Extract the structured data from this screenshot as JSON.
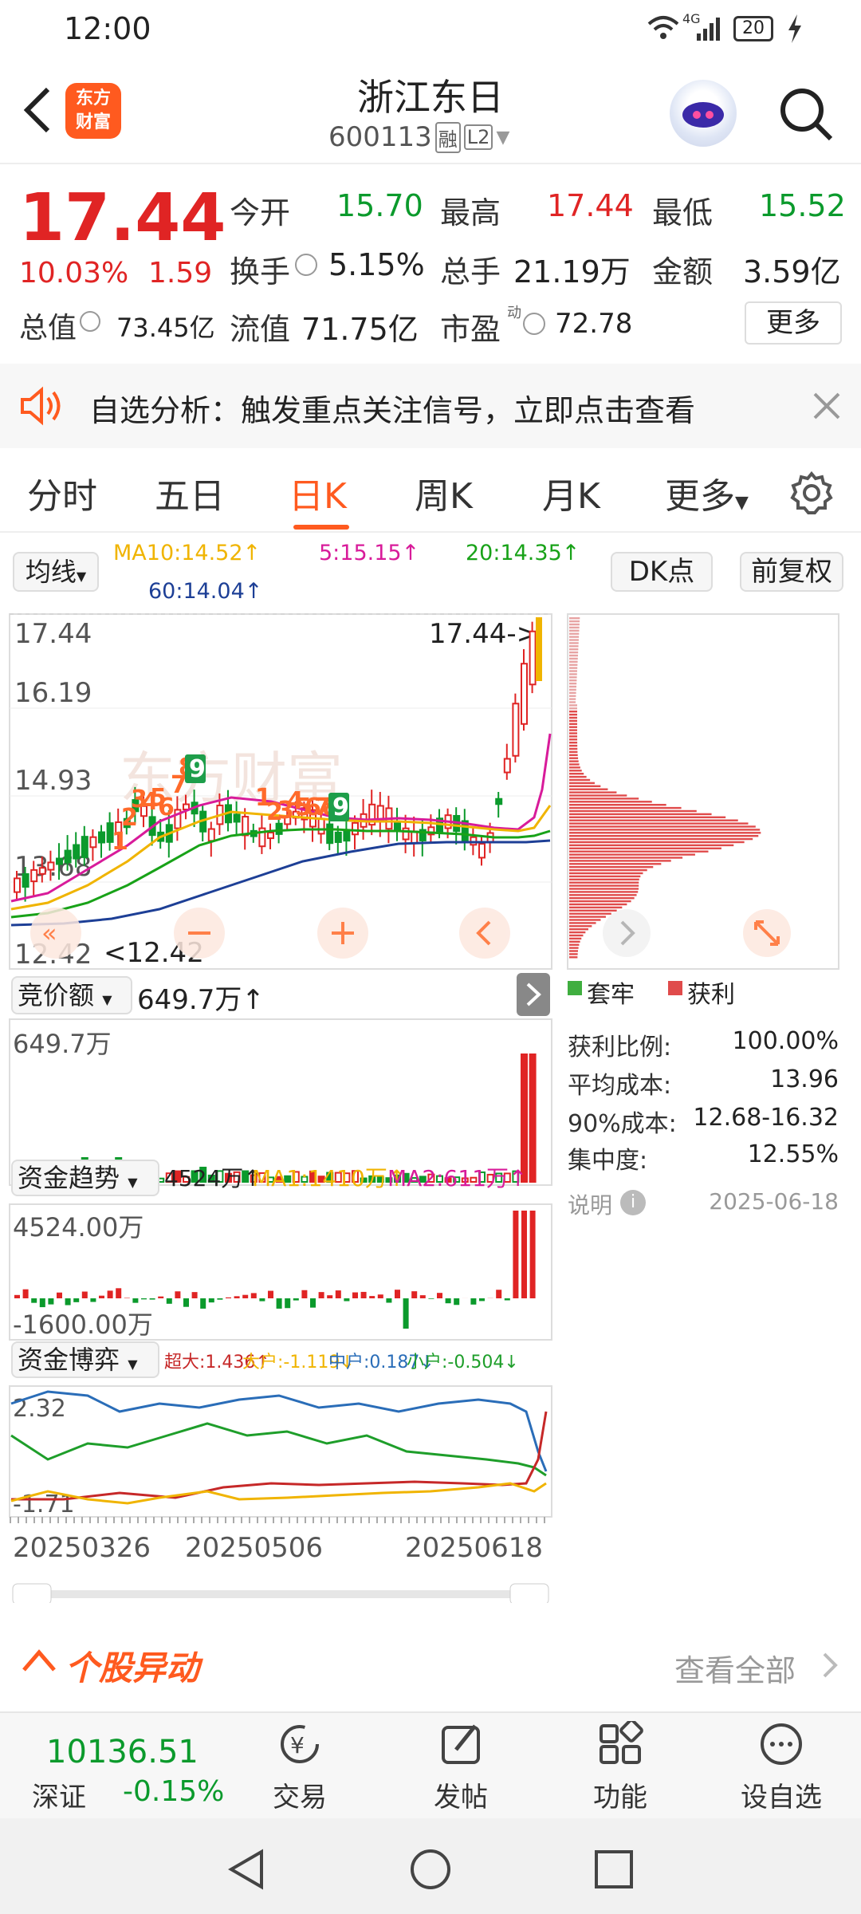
{
  "status": {
    "time": "12:00",
    "network": "4G",
    "battery": "20"
  },
  "header": {
    "title": "浙江东日",
    "code": "600113",
    "tag1": "融",
    "tag2": "L2",
    "logo_line1": "东方",
    "logo_line2": "财富"
  },
  "quote": {
    "price": "17.44",
    "pct": "10.03%",
    "change": "1.59",
    "open_label": "今开",
    "open": "15.70",
    "high_label": "最高",
    "high": "17.44",
    "low_label": "最低",
    "low": "15.52",
    "turnover_label": "换手",
    "turnover": "5.15%",
    "volume_label": "总手",
    "volume": "21.19万",
    "amount_label": "金额",
    "amount": "3.59亿",
    "mcap_label": "总值",
    "mcap": "73.45亿",
    "float_label": "流值",
    "float": "71.75亿",
    "pe_label": "市盈",
    "pe_sup": "动",
    "pe": "72.78",
    "more": "更多"
  },
  "notice": {
    "text": "自选分析：触发重点关注信号，立即点击查看"
  },
  "tabs": [
    "分时",
    "五日",
    "日K",
    "周K",
    "月K",
    "更多"
  ],
  "active_tab": "日K",
  "ma": {
    "selector": "均线",
    "ma10": "MA10:14.52↑",
    "ma5": "5:15.15↑",
    "ma20": "20:14.35↑",
    "ma60": "60:14.04↑",
    "dk": "DK点",
    "adjust": "前复权"
  },
  "kline": {
    "ticks": [
      "17.44",
      "16.19",
      "14.93",
      "13.68",
      "12.42"
    ],
    "last_tag": "17.44->",
    "low_tag": "<12.42",
    "watermark": "东方财富",
    "seq1": [
      "1",
      "2",
      "3",
      "4",
      "5",
      "6",
      "7",
      "8",
      "9"
    ],
    "seq2": [
      "1",
      "2",
      "3",
      "4",
      "5",
      "6",
      "7",
      "8",
      "9"
    ]
  },
  "volume_panel": {
    "selector": "竞价额",
    "value": "649.7万↑",
    "ymax": "649.7万"
  },
  "flow_panel": {
    "selector": "资金趋势",
    "value": "4524万↑",
    "ma1": "MA1:1410万↑",
    "ma2": "MA2:611万↑",
    "ymax": "4524.00万",
    "ymin": "-1600.00万"
  },
  "game_panel": {
    "selector": "资金博弈",
    "super": "超大:1.436↑",
    "big": "大户:-1.119↓",
    "mid": "中户:0.187↓",
    "small": "小户:-0.504↓",
    "ymax": "2.32",
    "ymin": "-1.71"
  },
  "dates": [
    "20250326",
    "20250506",
    "20250618"
  ],
  "chip": {
    "legend1": "套牢",
    "legend2": "获利",
    "rows": [
      {
        "label": "获利比例:",
        "value": "100.00%"
      },
      {
        "label": "平均成本:",
        "value": "13.96"
      },
      {
        "label": "90%成本:",
        "value": "12.68-16.32"
      },
      {
        "label": "集中度:",
        "value": "12.55%"
      }
    ],
    "note": "说明",
    "date": "2025-06-18"
  },
  "anomaly": {
    "title": "个股异动",
    "link": "查看全部"
  },
  "index": {
    "value": "10136.51",
    "name": "深证",
    "pct": "-0.15%"
  },
  "nav": [
    "交易",
    "发帖",
    "功能",
    "设自选"
  ],
  "colors": {
    "up": "#e02424",
    "down": "#0b9a2c",
    "ma10": "#f0b400",
    "ma5": "#d81b9a",
    "ma20": "#18a218",
    "ma60": "#1d3f96",
    "accent": "#ff5a1f"
  }
}
